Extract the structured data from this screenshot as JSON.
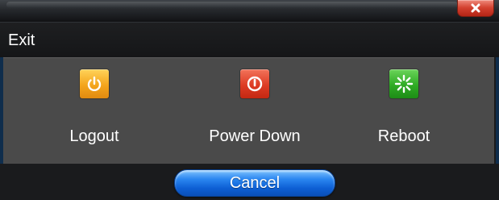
{
  "dialog": {
    "title": "Exit",
    "close_icon": "close-icon",
    "close_color": "#d3412f"
  },
  "actions": [
    {
      "label": "Logout",
      "icon": "power-icon",
      "color": "#f4a51c"
    },
    {
      "label": "Power Down",
      "icon": "shutdown-icon",
      "color": "#dd3b24"
    },
    {
      "label": "Reboot",
      "icon": "reboot-spinner-icon",
      "color": "#2fab24"
    }
  ],
  "footer": {
    "cancel_label": "Cancel",
    "cancel_color": "#1a6fe0"
  }
}
